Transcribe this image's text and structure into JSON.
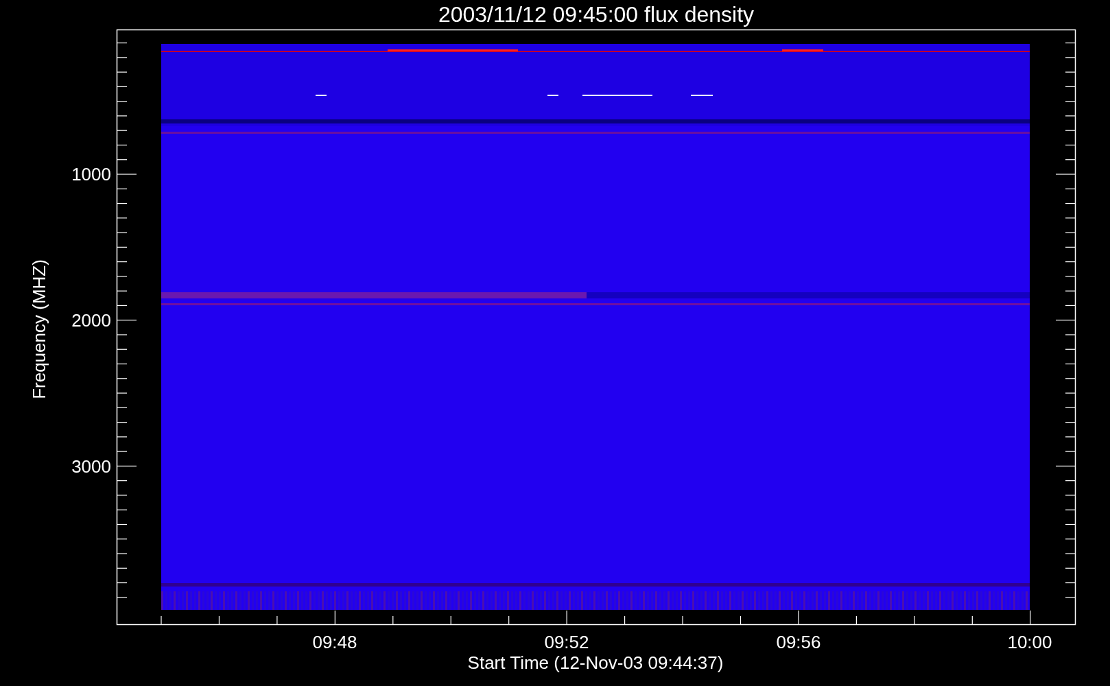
{
  "plot": {
    "title": "2003/11/12 09:45:00 flux density",
    "y_axis": {
      "label": "Frequency (MHZ)",
      "tick_labels": [
        "1000",
        "2000",
        "3000"
      ]
    },
    "x_axis": {
      "label": "Start Time (12-Nov-03 09:44:37)",
      "tick_labels": [
        "09:48",
        "09:52",
        "09:56",
        "10:00"
      ]
    }
  }
}
